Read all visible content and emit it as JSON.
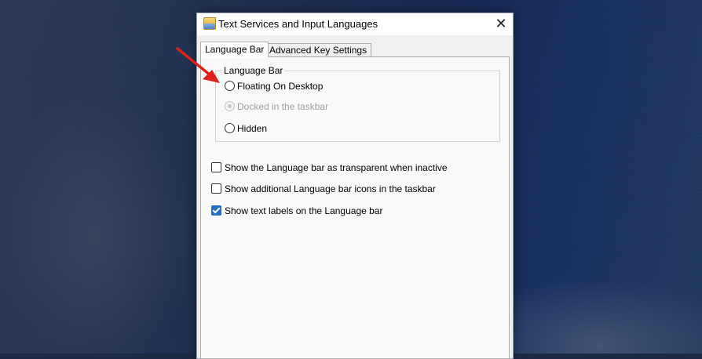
{
  "dialog": {
    "title": "Text Services and Input Languages",
    "close_glyph": "✕",
    "tabs": [
      {
        "label": "Language Bar",
        "active": true
      },
      {
        "label": "Advanced Key Settings",
        "active": false
      }
    ],
    "group": {
      "legend": "Language Bar",
      "options": [
        {
          "label": "Floating On Desktop",
          "checked": false,
          "disabled": false
        },
        {
          "label": "Docked in the taskbar",
          "checked": true,
          "disabled": true
        },
        {
          "label": "Hidden",
          "checked": false,
          "disabled": false
        }
      ]
    },
    "checkboxes": [
      {
        "label": "Show the Language bar as transparent when inactive",
        "checked": false
      },
      {
        "label": "Show additional Language bar icons in the taskbar",
        "checked": false
      },
      {
        "label": "Show text labels on the Language bar",
        "checked": true
      }
    ]
  },
  "icons": {
    "title_icon": "keyboard-language-icon",
    "close_icon": "close-icon",
    "annotation": "red-arrow-icon"
  },
  "colors": {
    "accent": "#1f6fc5",
    "arrow": "#e0201a"
  }
}
